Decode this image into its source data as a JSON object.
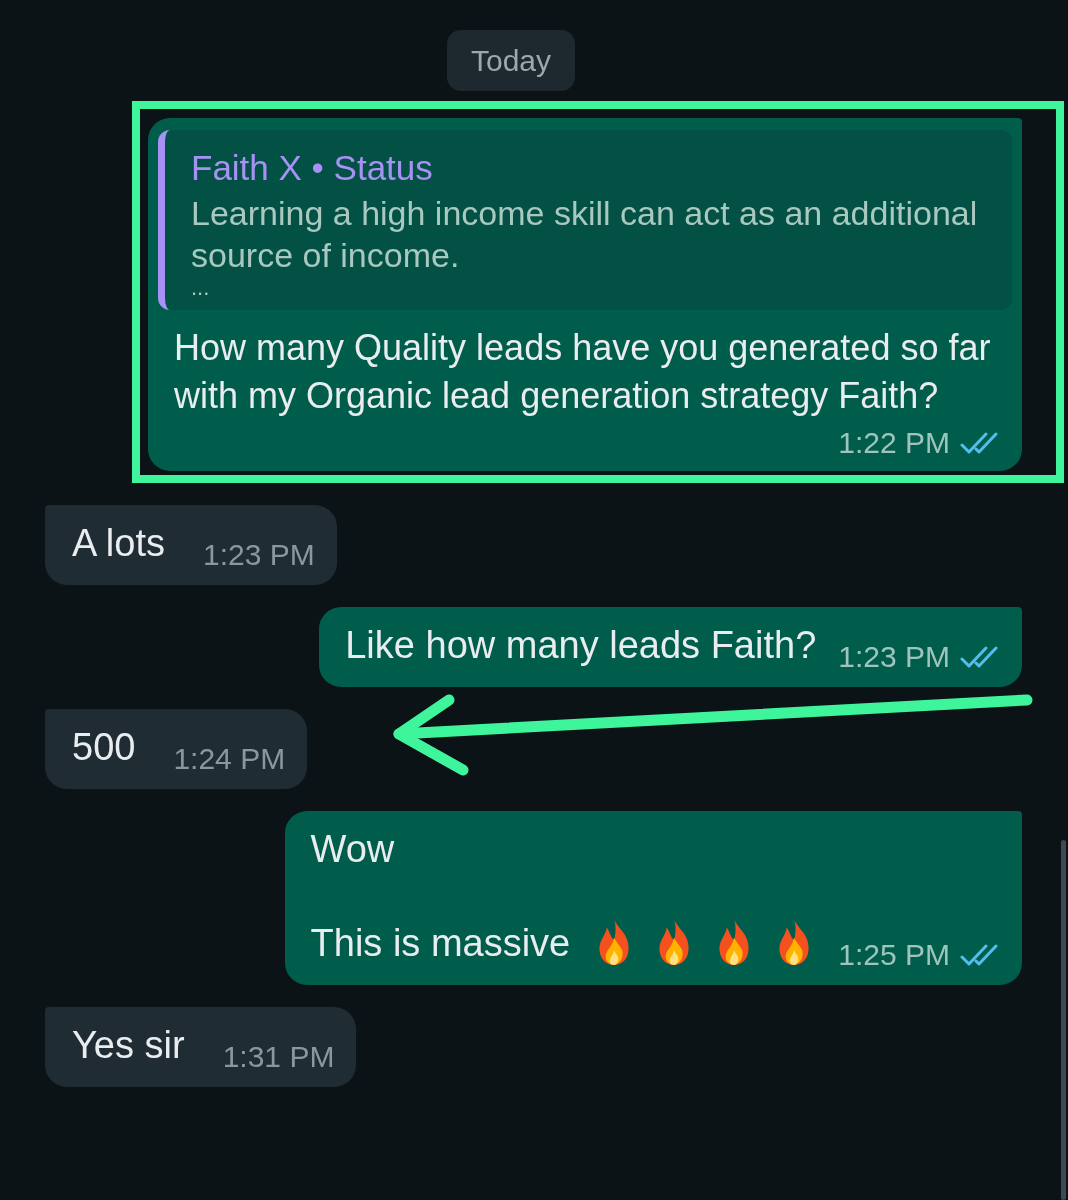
{
  "date_label": "Today",
  "messages": [
    {
      "kind": "outgoing",
      "highlighted": true,
      "pointed": false,
      "flames": false,
      "read": true,
      "quote": {
        "author": "Faith X • Status",
        "text": "Learning a high income skill can act as an additional source of income.",
        "more": "..."
      },
      "lines": [
        "How many Quality leads have you generated so far with my Organic lead generation strategy Faith?"
      ],
      "time": "1:22 PM"
    },
    {
      "kind": "incoming",
      "highlighted": false,
      "pointed": false,
      "flames": false,
      "lines": [
        "A lots"
      ],
      "time": "1:23 PM"
    },
    {
      "kind": "outgoing",
      "highlighted": false,
      "pointed": false,
      "flames": false,
      "read": true,
      "lines": [
        "Like how many leads Faith?"
      ],
      "time": "1:23 PM"
    },
    {
      "kind": "incoming",
      "highlighted": false,
      "pointed": true,
      "flames": false,
      "lines": [
        "500"
      ],
      "time": "1:24 PM"
    },
    {
      "kind": "outgoing",
      "highlighted": false,
      "pointed": false,
      "flames": true,
      "read": true,
      "lines": [
        "Wow",
        "This is massive"
      ],
      "time": "1:25 PM"
    },
    {
      "kind": "incoming",
      "highlighted": false,
      "pointed": false,
      "flames": false,
      "lines": [
        "Yes sir"
      ],
      "time": "1:31 PM"
    }
  ]
}
